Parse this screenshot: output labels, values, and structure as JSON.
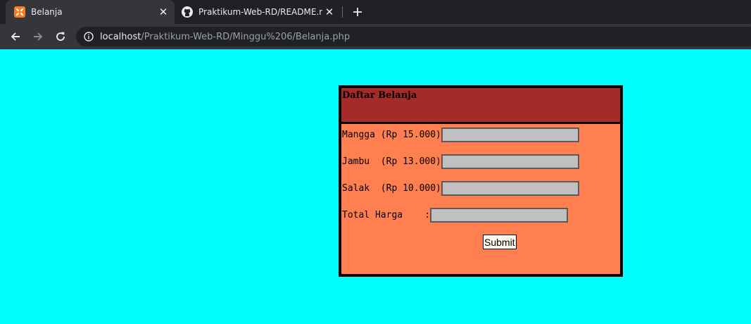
{
  "browser": {
    "tabs": [
      {
        "title": "Belanja",
        "active": true,
        "icon": "xampp-icon"
      },
      {
        "title": "Praktikum-Web-RD/README.md",
        "active": false,
        "icon": "github-icon"
      }
    ],
    "url_host": "localhost",
    "url_path": "/Praktikum-Web-RD/Minggu%206/Belanja.php"
  },
  "form": {
    "title": "Daftar Belanja",
    "rows": [
      {
        "label": "Mangga (Rp 15.000)",
        "value": ""
      },
      {
        "label": "Jambu  (Rp 13.000)",
        "value": ""
      },
      {
        "label": "Salak  (Rp 10.000)",
        "value": ""
      }
    ],
    "total_label": "Total Harga    :",
    "total_value": "",
    "submit_label": "Submit"
  },
  "colors": {
    "page_bg": "#00ffff",
    "header_bg": "#a52a2a",
    "form_bg": "#ff7f50",
    "field_bg": "#c0c0c0"
  }
}
